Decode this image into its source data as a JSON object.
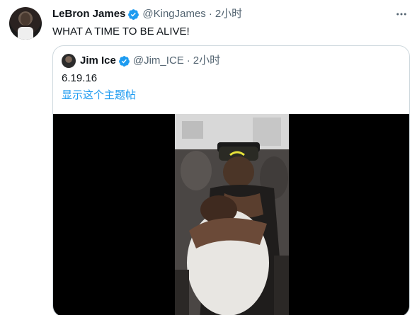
{
  "tweet": {
    "author_name": "LeBron James",
    "author_handle": "@KingJames",
    "separator": "·",
    "time": "2小时",
    "text": "WHAT A TIME TO BE ALIVE!",
    "verified": true
  },
  "quote": {
    "author_name": "Jim Ice",
    "author_handle": "@Jim_ICE",
    "separator": "·",
    "time": "2小时",
    "text": "6.19.16",
    "show_thread_label": "显示这个主题帖",
    "verified": true
  },
  "colors": {
    "verified_blue": "#1d9bf0",
    "link_blue": "#1d9bf0",
    "secondary_text": "#536471",
    "border": "#cfd9de"
  },
  "icons": {
    "verified": "verified-badge-icon",
    "more": "more-options-icon"
  }
}
